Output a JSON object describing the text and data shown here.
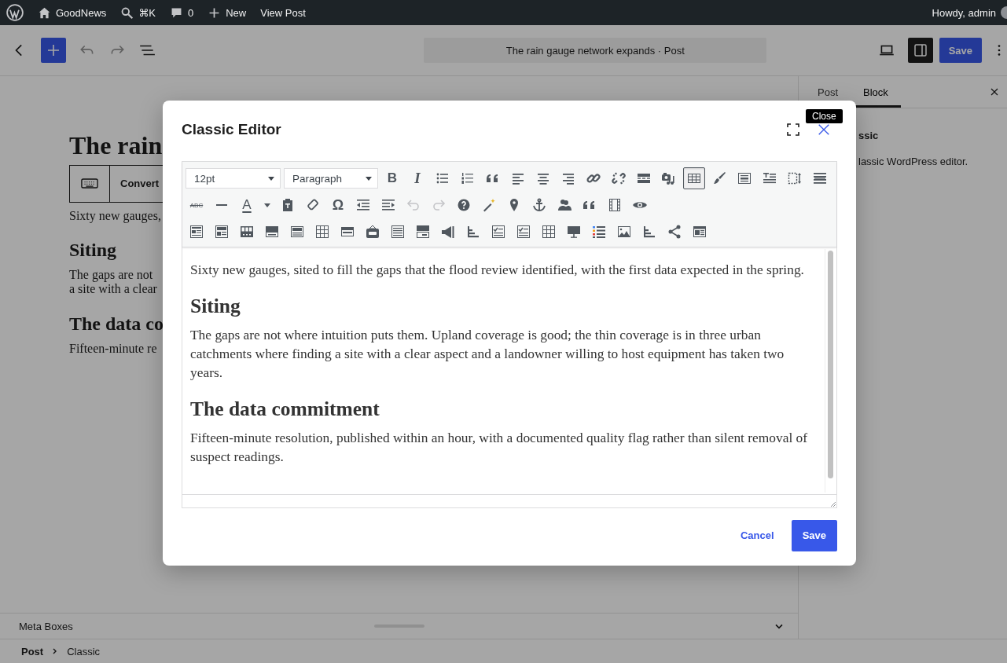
{
  "admin_bar": {
    "site": "GoodNews",
    "shortcut": "⌘K",
    "comments": "0",
    "new": "New",
    "view": "View Post",
    "greeting": "Howdy, admin"
  },
  "header": {
    "document_title": "The rain gauge network expands · Post",
    "save": "Save"
  },
  "canvas": {
    "title": "The rain",
    "convert_button": "Convert",
    "blocks": [
      {
        "kind": "paragraph",
        "lines": [
          "Sixty new gauges,"
        ]
      },
      {
        "kind": "heading",
        "lines": [
          "Siting"
        ]
      },
      {
        "kind": "paragraph",
        "lines": [
          "The gaps are not",
          "a site with a clear"
        ]
      },
      {
        "kind": "heading",
        "lines": [
          "The data co"
        ]
      },
      {
        "kind": "paragraph",
        "lines": [
          "Fifteen-minute re"
        ]
      }
    ]
  },
  "sidebar": {
    "tabs": [
      {
        "label": "Post",
        "selected": false
      },
      {
        "label": "Block",
        "selected": true
      }
    ],
    "block_name": "ssic",
    "block_description": "lassic WordPress editor."
  },
  "meta_boxes": {
    "label": "Meta Boxes"
  },
  "breadcrumb": [
    "Post",
    "Classic"
  ],
  "modal": {
    "title": "Classic Editor",
    "close_tooltip": "Close",
    "font_size": "12pt",
    "format": "Paragraph",
    "toolbar_rows": [
      [
        {
          "label": "B",
          "active": false
        },
        {
          "label": "I",
          "active": false
        },
        {
          "active": false
        },
        {
          "active": false
        },
        {
          "active": false
        },
        {
          "active": false
        },
        {
          "active": false
        },
        {
          "active": false
        },
        {
          "active": false
        },
        {
          "active": false
        },
        {
          "active": false
        },
        {
          "active": false
        },
        {
          "active": true
        },
        {
          "active": false
        },
        {
          "active": false
        },
        {
          "active": false
        },
        {
          "active": false
        },
        {
          "active": false
        }
      ],
      [
        {
          "label": "ABC",
          "active": false
        },
        {
          "active": false
        },
        {
          "label": "A",
          "active": false
        },
        {
          "active": false
        },
        {
          "active": false
        },
        {
          "active": false
        },
        {
          "label": "Ω",
          "active": false
        },
        {
          "active": false
        },
        {
          "active": false
        },
        {
          "active": false,
          "disabled": true
        },
        {
          "active": false,
          "disabled": true
        },
        {
          "active": false
        },
        {
          "active": false
        },
        {
          "active": false
        },
        {
          "active": false
        },
        {
          "active": false
        },
        {
          "active": false
        },
        {
          "active": false
        },
        {
          "active": false
        }
      ],
      [
        {
          "active": false
        },
        {
          "active": false
        },
        {
          "active": false
        },
        {
          "active": false
        },
        {
          "active": false
        },
        {
          "active": false
        },
        {
          "active": false
        },
        {
          "active": false
        },
        {
          "active": false
        },
        {
          "active": false
        },
        {
          "active": false
        },
        {
          "active": false
        },
        {
          "active": false
        },
        {
          "active": false
        },
        {
          "active": false
        },
        {
          "active": false
        },
        {
          "active": false
        },
        {
          "active": false
        },
        {
          "active": false
        },
        {
          "active": false
        },
        {
          "active": false
        }
      ]
    ],
    "content": [
      {
        "kind": "paragraph",
        "text": "Sixty new gauges, sited to fill the gaps that the flood review identified, with the first data expected in the spring."
      },
      {
        "kind": "heading",
        "text": "Siting"
      },
      {
        "kind": "paragraph",
        "text": "The gaps are not where intuition puts them. Upland coverage is good; the thin coverage is in three urban catchments where finding a site with a clear aspect and a landowner willing to host equipment has taken two years."
      },
      {
        "kind": "heading",
        "text": "The data commitment"
      },
      {
        "kind": "paragraph",
        "text": "Fifteen-minute resolution, published within an hour, with a documented quality flag rather than silent removal of suspect readings."
      }
    ],
    "cancel": "Cancel",
    "save": "Save"
  }
}
